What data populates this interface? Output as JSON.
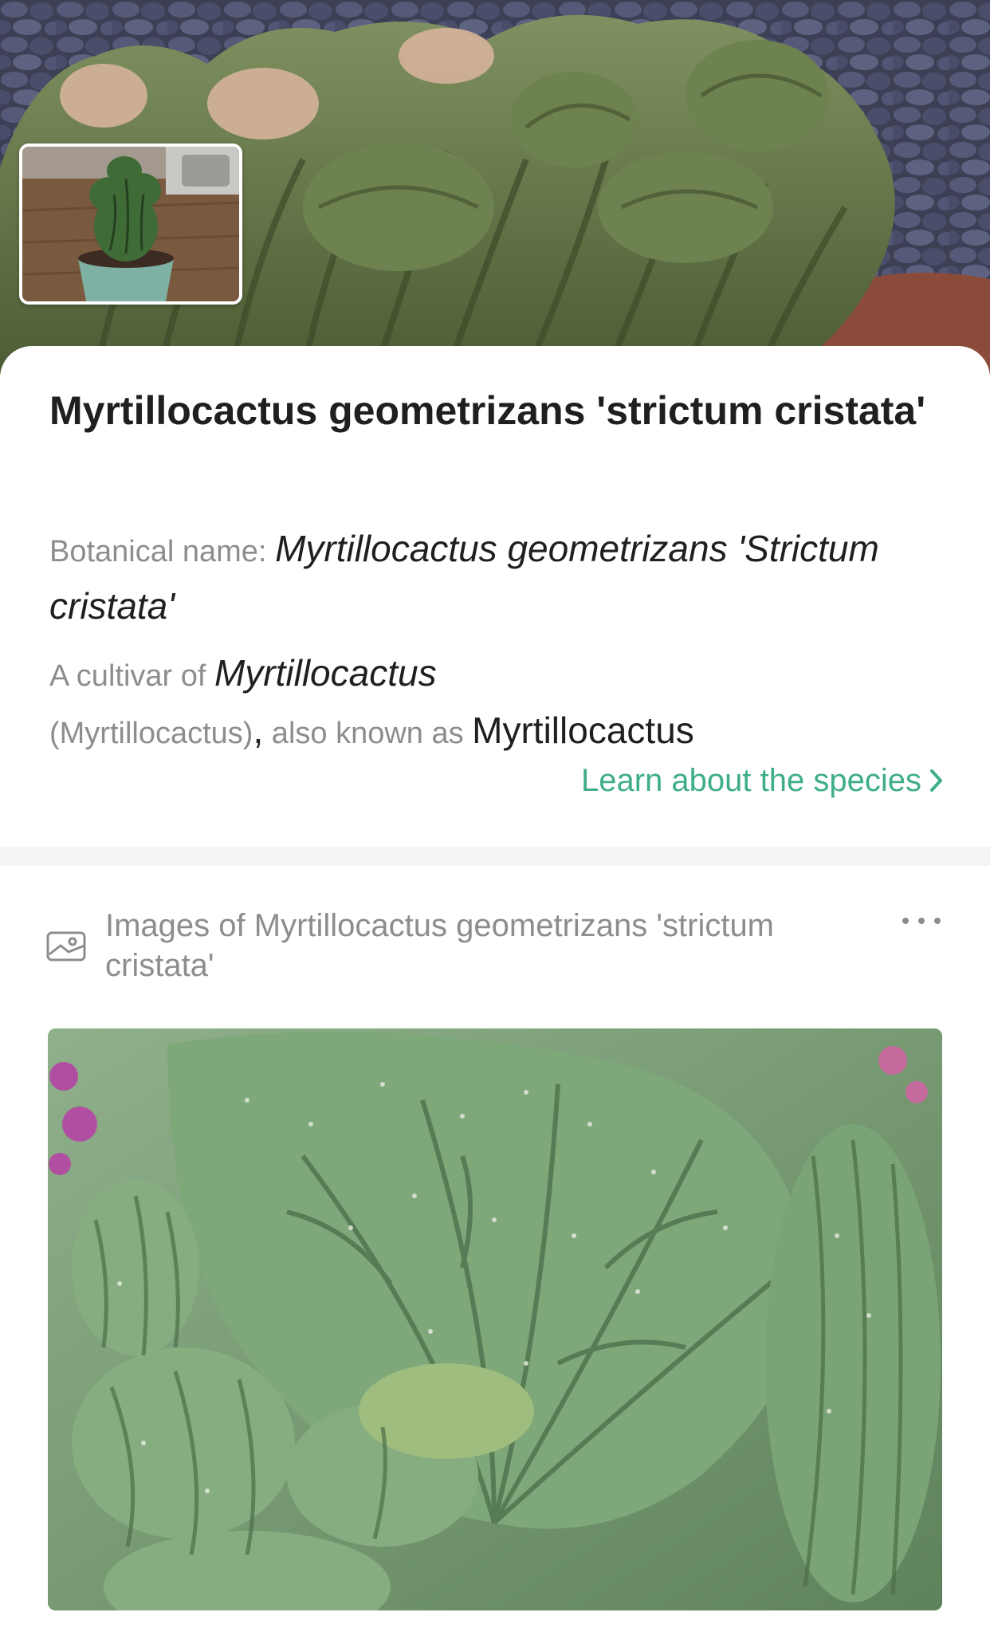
{
  "hero": {
    "photo_alt": "crested cactus photo"
  },
  "thumbnail": {
    "photo_alt": "user photo of potted cactus"
  },
  "plant": {
    "common_name": "Myrtillocactus geometrizans 'strictum cristata'",
    "botanical_label": "Botanical name: ",
    "botanical_name": "Myrtillocactus geometrizans 'Strictum cristata'",
    "cultivar_prefix": "A cultivar of ",
    "cultivar_genus": "Myrtillocactus",
    "cultivar_paren": " (Myrtillocactus)",
    "comma": ",",
    "aka_prefix": " also known as ",
    "aka_name": "Myrtillocactus",
    "learn_link": "Learn about the species"
  },
  "images_section": {
    "title": "Images of Myrtillocactus geometrizans 'strictum cristata'",
    "icon": "image-icon",
    "more_icon": "more-horizontal-icon"
  },
  "colors": {
    "accent": "#3fae86",
    "text_primary": "#1f1f1f",
    "text_secondary": "#8d8d8d",
    "divider": "#f3f4f6"
  }
}
